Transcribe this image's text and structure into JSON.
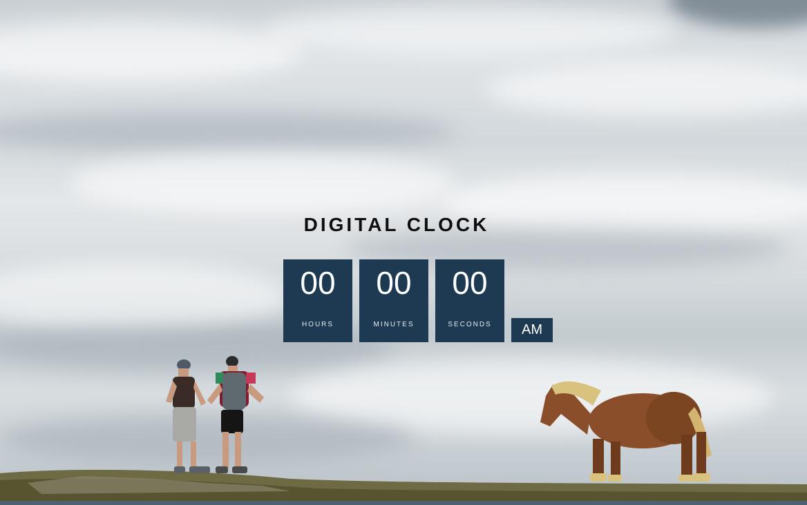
{
  "clock": {
    "title": "DIGITAL CLOCK",
    "hours": {
      "value": "00",
      "label": "HOURS"
    },
    "minutes": {
      "value": "00",
      "label": "MINUTES"
    },
    "seconds": {
      "value": "00",
      "label": "SECONDS"
    },
    "period": "AM"
  },
  "background": {
    "scene": "two hikers and a horse on a hilltop above a sea of clouds"
  },
  "colors": {
    "tile": "#1e3a52",
    "tile_text": "#ffffff",
    "title_text": "#0e0e0e"
  }
}
